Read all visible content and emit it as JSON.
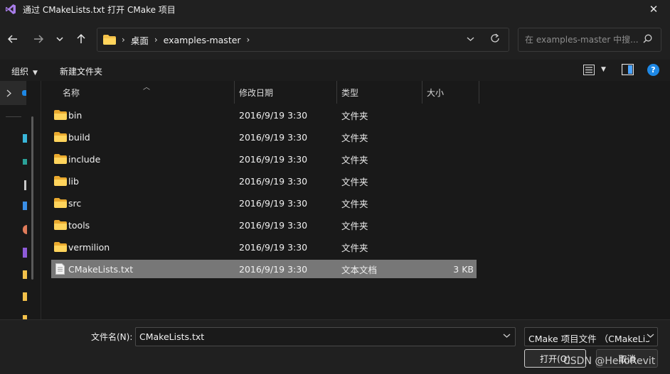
{
  "window": {
    "title": "通过 CMakeLists.txt 打开 CMake 项目",
    "close_glyph": "✕"
  },
  "nav": {
    "breadcrumbs": [
      "桌面",
      "examples-master"
    ],
    "search_placeholder": "在 examples-master 中搜..."
  },
  "toolbar": {
    "organize": "组织",
    "new_folder": "新建文件夹"
  },
  "columns": {
    "name": "名称",
    "modified": "修改日期",
    "type": "类型",
    "size": "大小"
  },
  "files": [
    {
      "name": "bin",
      "modified": "2016/9/19 3:30",
      "type": "文件夹",
      "size": "",
      "kind": "folder"
    },
    {
      "name": "build",
      "modified": "2016/9/19 3:30",
      "type": "文件夹",
      "size": "",
      "kind": "folder"
    },
    {
      "name": "include",
      "modified": "2016/9/19 3:30",
      "type": "文件夹",
      "size": "",
      "kind": "folder"
    },
    {
      "name": "lib",
      "modified": "2016/9/19 3:30",
      "type": "文件夹",
      "size": "",
      "kind": "folder"
    },
    {
      "name": "src",
      "modified": "2016/9/19 3:30",
      "type": "文件夹",
      "size": "",
      "kind": "folder"
    },
    {
      "name": "tools",
      "modified": "2016/9/19 3:30",
      "type": "文件夹",
      "size": "",
      "kind": "folder"
    },
    {
      "name": "vermilion",
      "modified": "2016/9/19 3:30",
      "type": "文件夹",
      "size": "",
      "kind": "folder"
    },
    {
      "name": "CMakeLists.txt",
      "modified": "2016/9/19 3:30",
      "type": "文本文档",
      "size": "3 KB",
      "kind": "file",
      "selected": true
    }
  ],
  "bottom": {
    "filename_label": "文件名(N):",
    "filename_value": "CMakeLists.txt",
    "filetype_value": "CMake 项目文件 （CMakeLis",
    "open_label": "打开(O)",
    "cancel_label": "取消"
  },
  "watermark": "CSDN @HelloRevit",
  "colors": {
    "background": "#191919",
    "selected_row": "#777777",
    "folder": "#f3c14a",
    "help": "#1e88e5"
  }
}
